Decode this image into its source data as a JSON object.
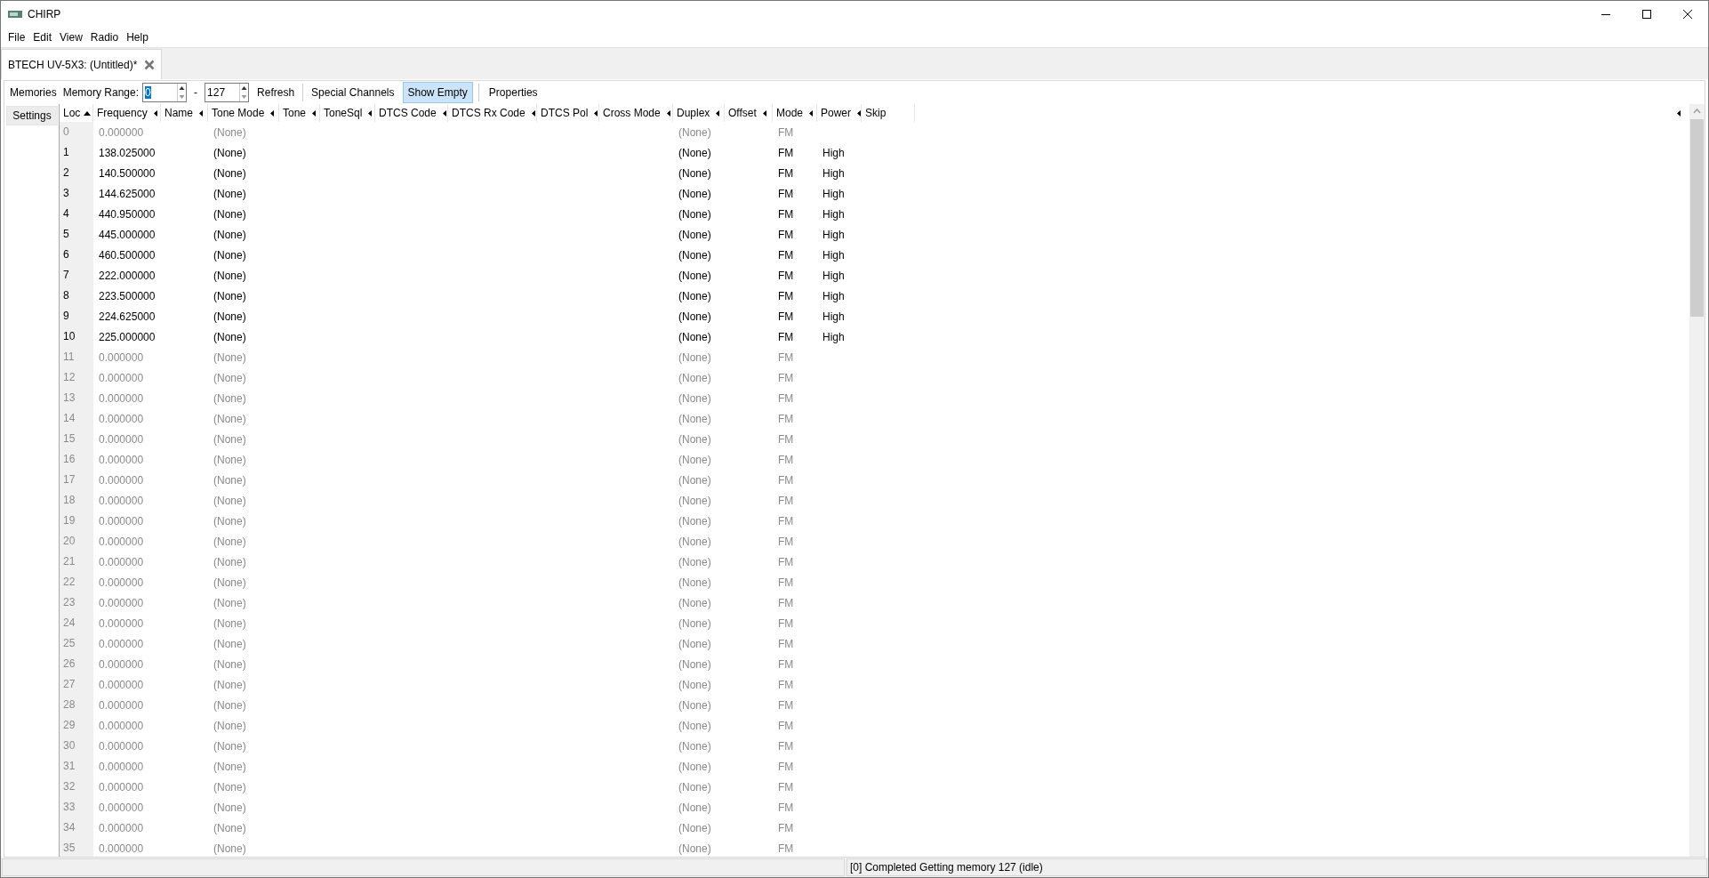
{
  "window": {
    "title": "CHIRP"
  },
  "menu": [
    "File",
    "Edit",
    "View",
    "Radio",
    "Help"
  ],
  "tabs": [
    {
      "label": "BTECH UV-5X3: (Untitled)*",
      "selected": true
    }
  ],
  "side_tabs": [
    {
      "label": "Memories",
      "selected": true
    },
    {
      "label": "Settings",
      "selected": false
    }
  ],
  "toolbar": {
    "range_label": "Memory Range:",
    "range_start": "0",
    "range_dash": "-",
    "range_end": "127",
    "refresh": "Refresh",
    "special": "Special Channels",
    "show_empty": {
      "label": "Show Empty",
      "pressed": true
    },
    "properties": "Properties"
  },
  "columns": [
    {
      "label": "Loc",
      "sorted": true,
      "arrow": false
    },
    {
      "label": "Frequency",
      "sorted": false,
      "arrow": true
    },
    {
      "label": "Name",
      "sorted": false,
      "arrow": true
    },
    {
      "label": "Tone Mode",
      "sorted": false,
      "arrow": true
    },
    {
      "label": "Tone",
      "sorted": false,
      "arrow": true
    },
    {
      "label": "ToneSql",
      "sorted": false,
      "arrow": true
    },
    {
      "label": "DTCS Code",
      "sorted": false,
      "arrow": true
    },
    {
      "label": "DTCS Rx Code",
      "sorted": false,
      "arrow": true
    },
    {
      "label": "DTCS Pol",
      "sorted": false,
      "arrow": true
    },
    {
      "label": "Cross Mode",
      "sorted": false,
      "arrow": true
    },
    {
      "label": "Duplex",
      "sorted": false,
      "arrow": true
    },
    {
      "label": "Offset",
      "sorted": false,
      "arrow": true
    },
    {
      "label": "Mode",
      "sorted": false,
      "arrow": true
    },
    {
      "label": "Power",
      "sorted": false,
      "arrow": true
    },
    {
      "label": "Skip",
      "sorted": false,
      "arrow": false
    }
  ],
  "rows": [
    {
      "loc": "0",
      "frequency": "0.000000",
      "tone_mode": "(None)",
      "duplex": "(None)",
      "mode": "FM",
      "empty": true
    },
    {
      "loc": "1",
      "frequency": "138.025000",
      "tone_mode": "(None)",
      "duplex": "(None)",
      "mode": "FM",
      "power": "High",
      "empty": false
    },
    {
      "loc": "2",
      "frequency": "140.500000",
      "tone_mode": "(None)",
      "duplex": "(None)",
      "mode": "FM",
      "power": "High",
      "empty": false
    },
    {
      "loc": "3",
      "frequency": "144.625000",
      "tone_mode": "(None)",
      "duplex": "(None)",
      "mode": "FM",
      "power": "High",
      "empty": false
    },
    {
      "loc": "4",
      "frequency": "440.950000",
      "tone_mode": "(None)",
      "duplex": "(None)",
      "mode": "FM",
      "power": "High",
      "empty": false
    },
    {
      "loc": "5",
      "frequency": "445.000000",
      "tone_mode": "(None)",
      "duplex": "(None)",
      "mode": "FM",
      "power": "High",
      "empty": false
    },
    {
      "loc": "6",
      "frequency": "460.500000",
      "tone_mode": "(None)",
      "duplex": "(None)",
      "mode": "FM",
      "power": "High",
      "empty": false
    },
    {
      "loc": "7",
      "frequency": "222.000000",
      "tone_mode": "(None)",
      "duplex": "(None)",
      "mode": "FM",
      "power": "High",
      "empty": false
    },
    {
      "loc": "8",
      "frequency": "223.500000",
      "tone_mode": "(None)",
      "duplex": "(None)",
      "mode": "FM",
      "power": "High",
      "empty": false
    },
    {
      "loc": "9",
      "frequency": "224.625000",
      "tone_mode": "(None)",
      "duplex": "(None)",
      "mode": "FM",
      "power": "High",
      "empty": false
    },
    {
      "loc": "10",
      "frequency": "225.000000",
      "tone_mode": "(None)",
      "duplex": "(None)",
      "mode": "FM",
      "power": "High",
      "empty": false
    },
    {
      "loc": "11",
      "frequency": "0.000000",
      "tone_mode": "(None)",
      "duplex": "(None)",
      "mode": "FM",
      "empty": true
    },
    {
      "loc": "12",
      "frequency": "0.000000",
      "tone_mode": "(None)",
      "duplex": "(None)",
      "mode": "FM",
      "empty": true
    },
    {
      "loc": "13",
      "frequency": "0.000000",
      "tone_mode": "(None)",
      "duplex": "(None)",
      "mode": "FM",
      "empty": true
    },
    {
      "loc": "14",
      "frequency": "0.000000",
      "tone_mode": "(None)",
      "duplex": "(None)",
      "mode": "FM",
      "empty": true
    },
    {
      "loc": "15",
      "frequency": "0.000000",
      "tone_mode": "(None)",
      "duplex": "(None)",
      "mode": "FM",
      "empty": true
    },
    {
      "loc": "16",
      "frequency": "0.000000",
      "tone_mode": "(None)",
      "duplex": "(None)",
      "mode": "FM",
      "empty": true
    },
    {
      "loc": "17",
      "frequency": "0.000000",
      "tone_mode": "(None)",
      "duplex": "(None)",
      "mode": "FM",
      "empty": true
    },
    {
      "loc": "18",
      "frequency": "0.000000",
      "tone_mode": "(None)",
      "duplex": "(None)",
      "mode": "FM",
      "empty": true
    },
    {
      "loc": "19",
      "frequency": "0.000000",
      "tone_mode": "(None)",
      "duplex": "(None)",
      "mode": "FM",
      "empty": true
    },
    {
      "loc": "20",
      "frequency": "0.000000",
      "tone_mode": "(None)",
      "duplex": "(None)",
      "mode": "FM",
      "empty": true
    },
    {
      "loc": "21",
      "frequency": "0.000000",
      "tone_mode": "(None)",
      "duplex": "(None)",
      "mode": "FM",
      "empty": true
    },
    {
      "loc": "22",
      "frequency": "0.000000",
      "tone_mode": "(None)",
      "duplex": "(None)",
      "mode": "FM",
      "empty": true
    },
    {
      "loc": "23",
      "frequency": "0.000000",
      "tone_mode": "(None)",
      "duplex": "(None)",
      "mode": "FM",
      "empty": true
    },
    {
      "loc": "24",
      "frequency": "0.000000",
      "tone_mode": "(None)",
      "duplex": "(None)",
      "mode": "FM",
      "empty": true
    },
    {
      "loc": "25",
      "frequency": "0.000000",
      "tone_mode": "(None)",
      "duplex": "(None)",
      "mode": "FM",
      "empty": true
    },
    {
      "loc": "26",
      "frequency": "0.000000",
      "tone_mode": "(None)",
      "duplex": "(None)",
      "mode": "FM",
      "empty": true
    },
    {
      "loc": "27",
      "frequency": "0.000000",
      "tone_mode": "(None)",
      "duplex": "(None)",
      "mode": "FM",
      "empty": true
    },
    {
      "loc": "28",
      "frequency": "0.000000",
      "tone_mode": "(None)",
      "duplex": "(None)",
      "mode": "FM",
      "empty": true
    },
    {
      "loc": "29",
      "frequency": "0.000000",
      "tone_mode": "(None)",
      "duplex": "(None)",
      "mode": "FM",
      "empty": true
    },
    {
      "loc": "30",
      "frequency": "0.000000",
      "tone_mode": "(None)",
      "duplex": "(None)",
      "mode": "FM",
      "empty": true
    },
    {
      "loc": "31",
      "frequency": "0.000000",
      "tone_mode": "(None)",
      "duplex": "(None)",
      "mode": "FM",
      "empty": true
    },
    {
      "loc": "32",
      "frequency": "0.000000",
      "tone_mode": "(None)",
      "duplex": "(None)",
      "mode": "FM",
      "empty": true
    },
    {
      "loc": "33",
      "frequency": "0.000000",
      "tone_mode": "(None)",
      "duplex": "(None)",
      "mode": "FM",
      "empty": true
    },
    {
      "loc": "34",
      "frequency": "0.000000",
      "tone_mode": "(None)",
      "duplex": "(None)",
      "mode": "FM",
      "empty": true
    },
    {
      "loc": "35",
      "frequency": "0.000000",
      "tone_mode": "(None)",
      "duplex": "(None)",
      "mode": "FM",
      "empty": true
    }
  ],
  "status_bar": {
    "message": "[0] Completed Getting memory 127 (idle)"
  }
}
